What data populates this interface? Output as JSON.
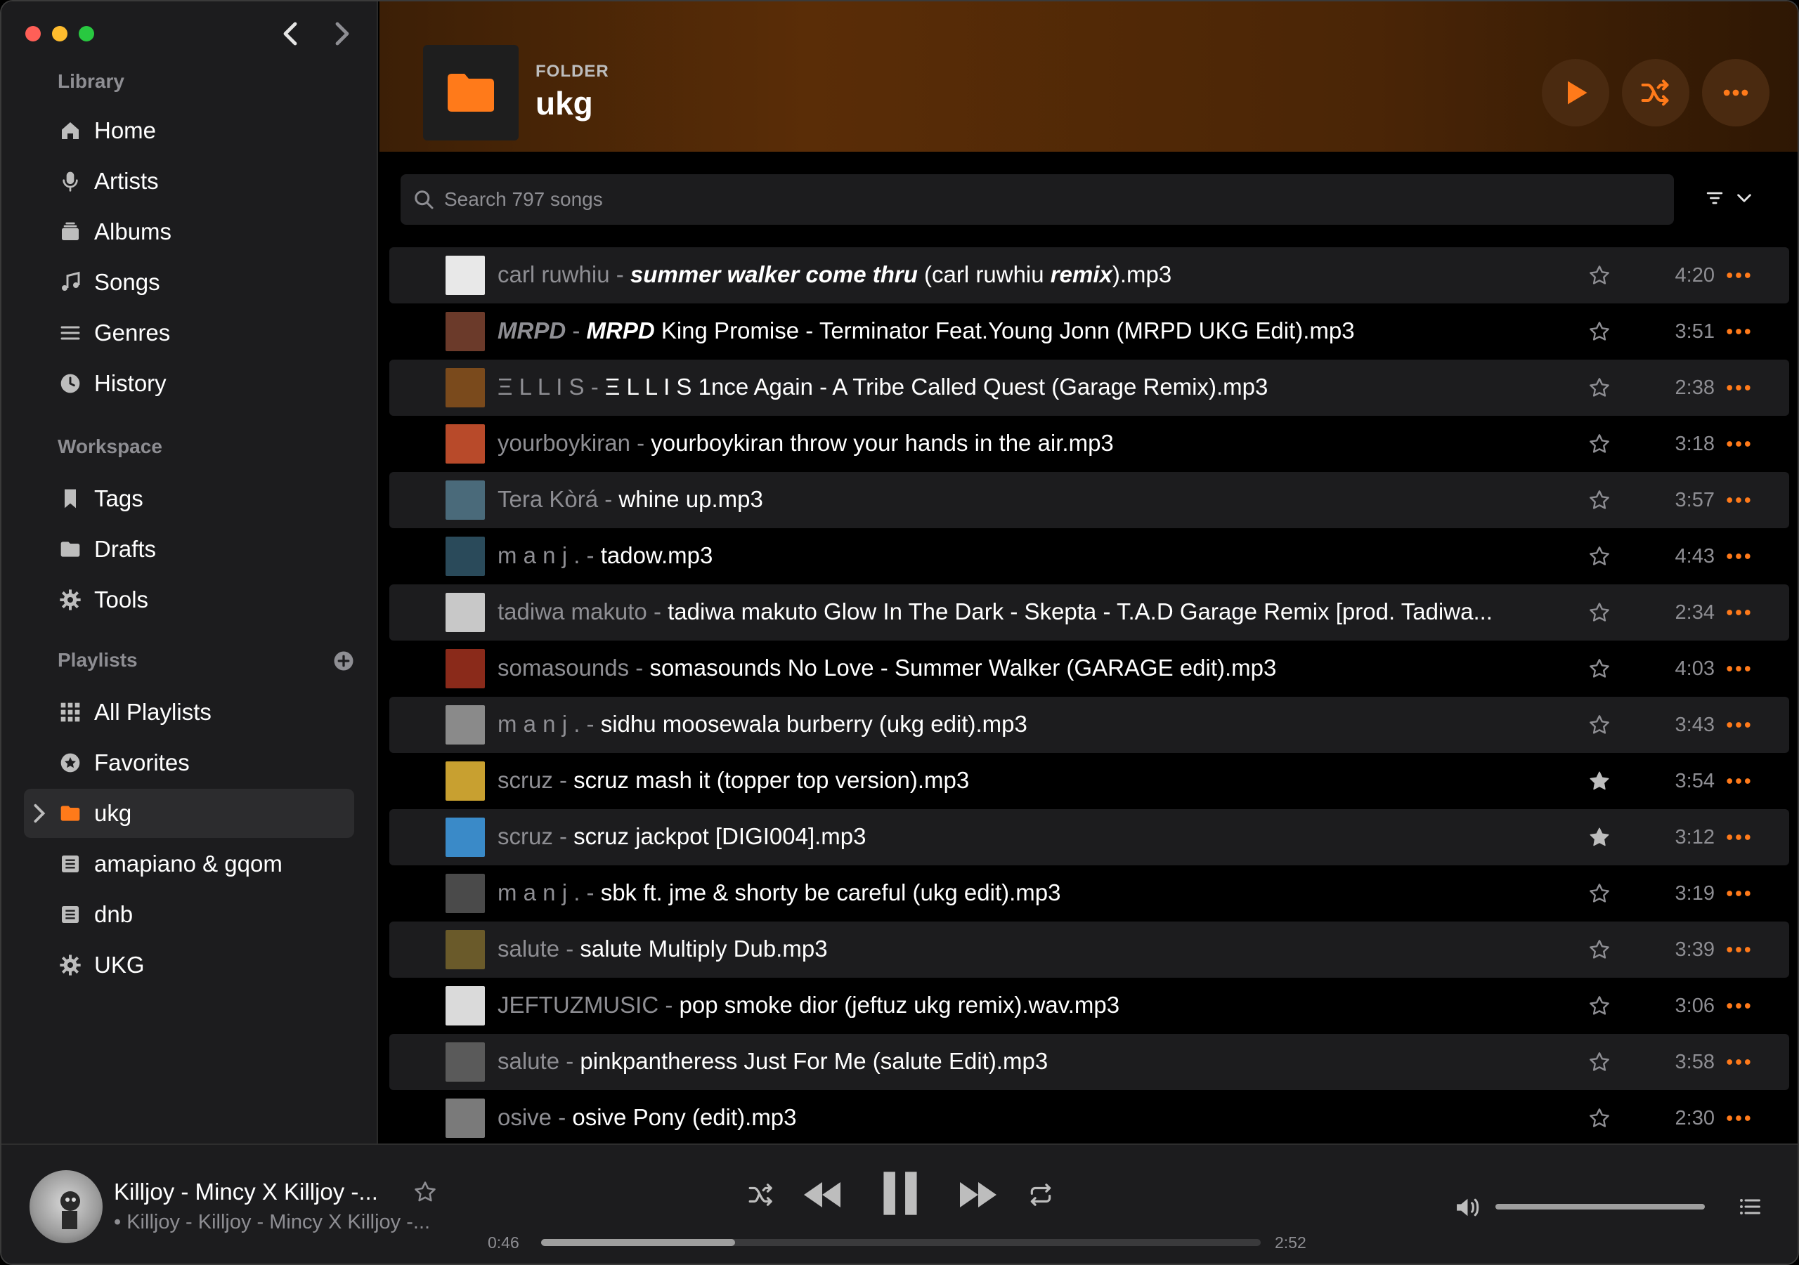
{
  "colors": {
    "accent": "#ff7a1a",
    "sidebar_bg": "#1c1c1e",
    "row_alt": "#1c1c1e",
    "muted_text": "#8e8e93"
  },
  "sidebar": {
    "library_label": "Library",
    "library": [
      {
        "label": "Home",
        "icon": "house-icon"
      },
      {
        "label": "Artists",
        "icon": "microphone-icon"
      },
      {
        "label": "Albums",
        "icon": "album-stack-icon"
      },
      {
        "label": "Songs",
        "icon": "music-note-icon"
      },
      {
        "label": "Genres",
        "icon": "list-lines-icon"
      },
      {
        "label": "History",
        "icon": "clock-icon"
      }
    ],
    "workspace_label": "Workspace",
    "workspace": [
      {
        "label": "Tags",
        "icon": "bookmark-icon"
      },
      {
        "label": "Drafts",
        "icon": "folder-icon"
      },
      {
        "label": "Tools",
        "icon": "gear-icon"
      }
    ],
    "playlists_label": "Playlists",
    "playlists": [
      {
        "label": "All Playlists",
        "icon": "grid-icon"
      },
      {
        "label": "Favorites",
        "icon": "star-circle-icon"
      },
      {
        "label": "ukg",
        "icon": "folder-icon",
        "active": true
      },
      {
        "label": "amapiano & gqom",
        "icon": "playlist-icon"
      },
      {
        "label": "dnb",
        "icon": "playlist-icon"
      },
      {
        "label": "UKG",
        "icon": "gear-icon"
      }
    ]
  },
  "header": {
    "kind": "FOLDER",
    "title": "ukg"
  },
  "search": {
    "placeholder": "Search 797 songs"
  },
  "songs": [
    {
      "artist": "carl ruwhiu",
      "title_parts": [
        [
          "summer walker come thru",
          "bi"
        ],
        [
          " (carl ruwhiu ",
          ""
        ],
        [
          "remix",
          "bi"
        ],
        [
          ").mp3",
          ""
        ]
      ],
      "duration": "4:20",
      "fav": false,
      "art": "#e8e8e8"
    },
    {
      "artist": "MRPD",
      "artist_italic": true,
      "title_parts": [
        [
          "MRPD",
          "bi"
        ],
        [
          " King Promise - Terminator Feat.Young Jonn (MRPD UKG Edit).mp3",
          ""
        ]
      ],
      "duration": "3:51",
      "fav": false,
      "art": "#6b3a2a"
    },
    {
      "artist": "Ξ L L I S",
      "title_parts": [
        [
          "Ξ L L I S 1nce Again - A Tribe Called Quest (Garage Remix).mp3",
          ""
        ]
      ],
      "duration": "2:38",
      "fav": false,
      "art": "#7a4a1c"
    },
    {
      "artist": "yourboykiran",
      "title_parts": [
        [
          "yourboykiran throw your hands in the air.mp3",
          ""
        ]
      ],
      "duration": "3:18",
      "fav": false,
      "art": "#b84a2a"
    },
    {
      "artist": "Tera Kòrá",
      "title_parts": [
        [
          "whine up.mp3",
          ""
        ]
      ],
      "duration": "3:57",
      "fav": false,
      "art": "#4a6a7a"
    },
    {
      "artist": "m a n j .",
      "title_parts": [
        [
          "tadow.mp3",
          ""
        ]
      ],
      "duration": "4:43",
      "fav": false,
      "art": "#2a4a5a"
    },
    {
      "artist": "tadiwa makuto",
      "title_parts": [
        [
          "tadiwa makuto Glow In The Dark - Skepta - T.A.D Garage Remix [prod. Tadiwa...",
          ""
        ]
      ],
      "duration": "2:34",
      "fav": false,
      "art": "#c8c8c8"
    },
    {
      "artist": "somasounds",
      "title_parts": [
        [
          "somasounds No Love - Summer Walker (GARAGE edit).mp3",
          ""
        ]
      ],
      "duration": "4:03",
      "fav": false,
      "art": "#8a2a1a"
    },
    {
      "artist": "m a n j .",
      "title_parts": [
        [
          "sidhu moosewala burberry (ukg edit).mp3",
          ""
        ]
      ],
      "duration": "3:43",
      "fav": false,
      "art": "#8a8a8a"
    },
    {
      "artist": "scruz",
      "title_parts": [
        [
          "scruz mash it (topper top version).mp3",
          ""
        ]
      ],
      "duration": "3:54",
      "fav": true,
      "art": "#c8a030"
    },
    {
      "artist": "scruz",
      "title_parts": [
        [
          "scruz jackpot [DIGI004].mp3",
          ""
        ]
      ],
      "duration": "3:12",
      "fav": true,
      "art": "#3a8ac8"
    },
    {
      "artist": "m a n j .",
      "title_parts": [
        [
          "sbk ft. jme & shorty be careful (ukg edit).mp3",
          ""
        ]
      ],
      "duration": "3:19",
      "fav": false,
      "art": "#4a4a4a"
    },
    {
      "artist": "salute",
      "title_parts": [
        [
          "salute Multiply Dub.mp3",
          ""
        ]
      ],
      "duration": "3:39",
      "fav": false,
      "art": "#6a5a2a"
    },
    {
      "artist": "JEFTUZMUSIC",
      "title_parts": [
        [
          "pop smoke dior (jeftuz ukg remix).wav.mp3",
          ""
        ]
      ],
      "duration": "3:06",
      "fav": false,
      "art": "#dadada"
    },
    {
      "artist": "salute",
      "title_parts": [
        [
          "pinkpantheress Just For Me (salute Edit).mp3",
          ""
        ]
      ],
      "duration": "3:58",
      "fav": false,
      "art": "#5a5a5a"
    },
    {
      "artist": "osive",
      "title_parts": [
        [
          "osive Pony (edit).mp3",
          ""
        ]
      ],
      "duration": "2:30",
      "fav": false,
      "art": "#7a7a7a"
    }
  ],
  "player": {
    "title": "Killjoy - Mincy X Killjoy -...",
    "subtitle": "• Killjoy - Killjoy - Mincy X Killjoy -...",
    "elapsed": "0:46",
    "total": "2:52",
    "progress": 0.27,
    "volume": 1.0
  }
}
